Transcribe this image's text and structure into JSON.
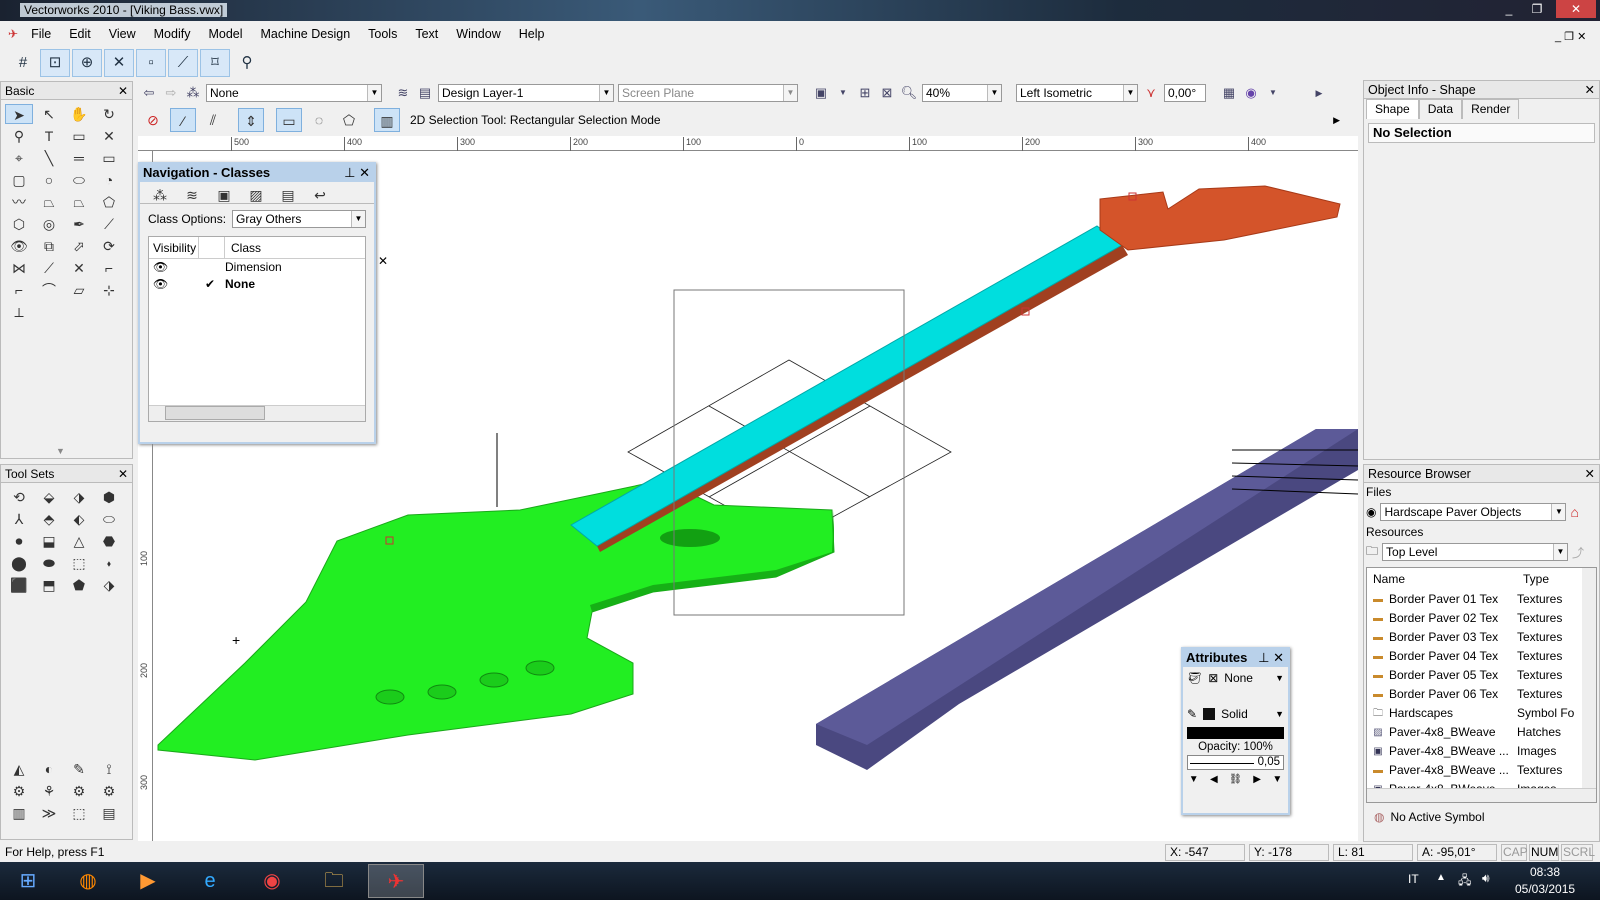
{
  "window": {
    "title": "Vectorworks 2010 - [Viking Bass.vwx]",
    "controls": [
      "minimize",
      "restore",
      "close"
    ]
  },
  "menu": [
    "File",
    "Edit",
    "View",
    "Modify",
    "Model",
    "Machine Design",
    "Tools",
    "Text",
    "Window",
    "Help"
  ],
  "snap_toolbar": [
    "snap-grid-icon",
    "snap-object-icon",
    "snap-angle-icon",
    "snap-intersection-icon",
    "snap-distance-icon",
    "smart-edge-icon",
    "snap-tangent-icon",
    "snap-surface-icon"
  ],
  "basic_palette": {
    "title": "Basic",
    "tools": [
      "selection",
      "pan-select",
      "pan",
      "flyover",
      "zoom",
      "text",
      "callout",
      "x-delete",
      "2d-locus",
      "line",
      "double-line",
      "rectangle",
      "rounded-rect",
      "circle",
      "oval",
      "arc",
      "freehand",
      "polygon",
      "polyline",
      "2d-poly",
      "regular-polygon",
      "spiral",
      "eyedropper",
      "attribute-mapping",
      "visibility",
      "offset",
      "reshape",
      "rotate",
      "mirror",
      "split",
      "trim",
      "fillet",
      "connect",
      "chamfer",
      "clip",
      "move-by-points",
      "dimension"
    ]
  },
  "tool_sets": {
    "title": "Tool Sets",
    "tools": [
      "3d-modeling",
      "sweep",
      "extrude",
      "3d-locus",
      "3d-power-pack",
      "push-pull",
      "loft",
      "sphere",
      "hemisphere",
      "cone",
      "pyramid",
      "protrusion",
      "shell",
      "fillet-edge",
      "chamfer-edge",
      "split-solid",
      "deform",
      "drilling",
      "taper",
      "twist"
    ],
    "bottom": [
      "design-palette",
      "lights",
      "dims-notes",
      "visualization",
      "building-shell",
      "site-planning",
      "machine-components",
      "walls-wedges",
      "detailing",
      "fasteners",
      "objects",
      "furniture"
    ]
  },
  "view_bar": {
    "class": "None",
    "layer": "Design Layer-1",
    "plane": "Screen Plane",
    "zoom": "40%",
    "view": "Left Isometric",
    "angle": "0,00°"
  },
  "mode_bar": {
    "status": "2D Selection Tool: Rectangular Selection Mode"
  },
  "ruler": {
    "h": [
      "500",
      "400",
      "300",
      "200",
      "100",
      "0",
      "100",
      "200",
      "300",
      "400"
    ],
    "v": [
      "100",
      "200",
      "300"
    ]
  },
  "navigation": {
    "title": "Navigation - Classes",
    "class_options_label": "Class Options:",
    "class_options": "Gray Others",
    "col_visibility": "Visibility",
    "col_class": "Class",
    "rows": [
      {
        "name": "Dimension",
        "active": false
      },
      {
        "name": "None",
        "active": true
      }
    ]
  },
  "object_info": {
    "title": "Object Info - Shape",
    "tabs": [
      "Shape",
      "Data",
      "Render"
    ],
    "selection": "No Selection"
  },
  "resource_browser": {
    "title": "Resource Browser",
    "files_label": "Files",
    "file": "Hardscape Paver Objects",
    "resources_label": "Resources",
    "folder": "Top Level",
    "col_name": "Name",
    "col_type": "Type",
    "items": [
      {
        "name": "Border Paver 01 Tex",
        "type": "Textures",
        "icon": "texture"
      },
      {
        "name": "Border Paver 02 Tex",
        "type": "Textures",
        "icon": "texture"
      },
      {
        "name": "Border Paver 03 Tex",
        "type": "Textures",
        "icon": "texture"
      },
      {
        "name": "Border Paver 04 Tex",
        "type": "Textures",
        "icon": "texture"
      },
      {
        "name": "Border Paver 05 Tex",
        "type": "Textures",
        "icon": "texture"
      },
      {
        "name": "Border Paver 06 Tex",
        "type": "Textures",
        "icon": "texture"
      },
      {
        "name": "Hardscapes",
        "type": "Symbol Fo",
        "icon": "folder"
      },
      {
        "name": "Paver-4x8_BWeave",
        "type": "Hatches",
        "icon": "hatch"
      },
      {
        "name": "Paver-4x8_BWeave ...",
        "type": "Images",
        "icon": "image"
      },
      {
        "name": "Paver-4x8_BWeave ...",
        "type": "Textures",
        "icon": "texture"
      },
      {
        "name": "Paver-4x8_BWeave ...",
        "type": "Images",
        "icon": "image"
      }
    ],
    "symbol": "No Active Symbol"
  },
  "attributes": {
    "title": "Attributes",
    "fill": "None",
    "pen": "Solid",
    "opacity": "Opacity: 100%",
    "line_weight": "0,05"
  },
  "status": {
    "help": "For Help, press F1",
    "x": "X: -547",
    "y": "Y: -178",
    "l": "L: 81",
    "a": "A: -95,01°",
    "cap": "CAP",
    "num": "NUM",
    "scrl": "SCRL"
  },
  "taskbar": {
    "apps": [
      "start",
      "firefox",
      "media-player",
      "internet-explorer",
      "chrome",
      "explorer",
      "vectorworks"
    ],
    "lang": "IT",
    "time": "08:38",
    "date": "05/03/2015"
  },
  "colors": {
    "body": "#22ee22",
    "neck": "#00dede",
    "head": "#d4542a",
    "bar": "#4a4880",
    "panel_header": "#b9d1ea"
  }
}
